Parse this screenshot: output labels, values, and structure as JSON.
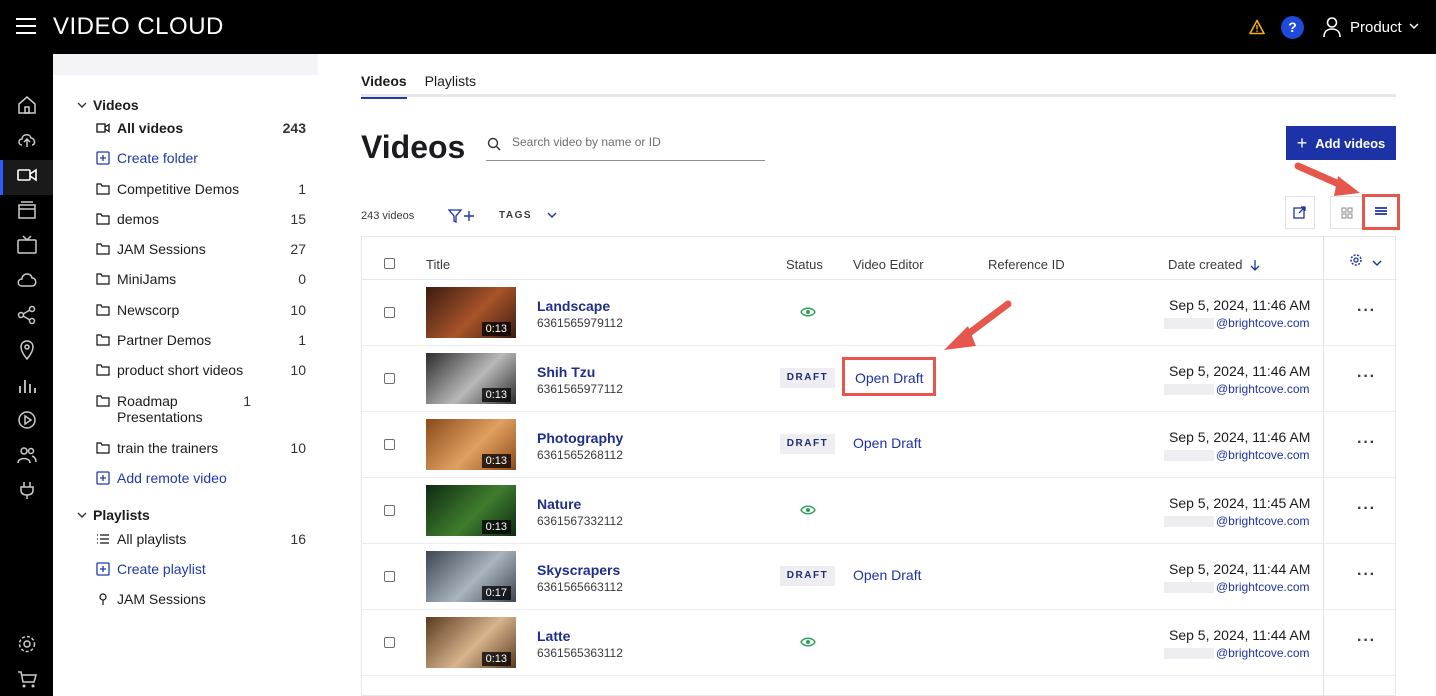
{
  "app": {
    "brand": "VIDEO CLOUD",
    "account": "Product"
  },
  "folders": {
    "videos_heading": "Videos",
    "items": [
      {
        "label": "All videos",
        "count": "243"
      },
      {
        "label": "Create folder",
        "count": ""
      },
      {
        "label": "Competitive Demos",
        "count": "1"
      },
      {
        "label": "demos",
        "count": "15"
      },
      {
        "label": "JAM Sessions",
        "count": "27"
      },
      {
        "label": "MiniJams",
        "count": "0"
      },
      {
        "label": "Newscorp",
        "count": "10"
      },
      {
        "label": "Partner Demos",
        "count": "1"
      },
      {
        "label": "product short videos",
        "count": "10"
      },
      {
        "label": "Roadmap Presentations",
        "count": "1"
      },
      {
        "label": "train the trainers",
        "count": "10"
      },
      {
        "label": "Add remote video",
        "count": ""
      }
    ],
    "playlists_heading": "Playlists",
    "playlist_items": [
      {
        "label": "All playlists",
        "count": "16"
      },
      {
        "label": "Create playlist",
        "count": ""
      },
      {
        "label": "JAM Sessions",
        "count": ""
      }
    ]
  },
  "main": {
    "tabs": [
      {
        "label": "Videos"
      },
      {
        "label": "Playlists"
      }
    ],
    "title": "Videos",
    "search_placeholder": "Search video by name or ID",
    "add_button": "Add videos",
    "video_count": "243 videos",
    "tags_label": "TAGS",
    "columns": {
      "title": "Title",
      "status": "Status",
      "editor": "Video Editor",
      "reference": "Reference ID",
      "date": "Date created"
    }
  },
  "videos": [
    {
      "title": "Landscape",
      "id": "6361565979112",
      "duration": "0:13",
      "status": "published",
      "draft_label": "",
      "editor": "",
      "date": "Sep 5, 2024, 11:46 AM",
      "email": "@brightcove.com",
      "thumb_a": "#3a1c10",
      "thumb_b": "#a8542a"
    },
    {
      "title": "Shih Tzu",
      "id": "6361565977112",
      "duration": "0:13",
      "status": "draft",
      "draft_label": "DRAFT",
      "editor": "Open Draft",
      "date": "Sep 5, 2024, 11:46 AM",
      "email": "@brightcove.com",
      "thumb_a": "#2c2c2c",
      "thumb_b": "#b9b9b9"
    },
    {
      "title": "Photography",
      "id": "6361565268112",
      "duration": "0:13",
      "status": "draft",
      "draft_label": "DRAFT",
      "editor": "Open Draft",
      "date": "Sep 5, 2024, 11:46 AM",
      "email": "@brightcove.com",
      "thumb_a": "#8a4a1a",
      "thumb_b": "#e0a060"
    },
    {
      "title": "Nature",
      "id": "6361567332112",
      "duration": "0:13",
      "status": "published",
      "draft_label": "",
      "editor": "",
      "date": "Sep 5, 2024, 11:45 AM",
      "email": "@brightcove.com",
      "thumb_a": "#0e2a12",
      "thumb_b": "#3f7d2e"
    },
    {
      "title": "Skyscrapers",
      "id": "6361565663112",
      "duration": "0:17",
      "status": "draft",
      "draft_label": "DRAFT",
      "editor": "Open Draft",
      "date": "Sep 5, 2024, 11:44 AM",
      "email": "@brightcove.com",
      "thumb_a": "#3c4650",
      "thumb_b": "#a9b4be"
    },
    {
      "title": "Latte",
      "id": "6361565363112",
      "duration": "0:13",
      "status": "published",
      "draft_label": "",
      "editor": "",
      "date": "Sep 5, 2024, 11:44 AM",
      "email": "@brightcove.com",
      "thumb_a": "#5a3a20",
      "thumb_b": "#d8b48c"
    }
  ],
  "colors": {
    "brand_blue": "#1e32a8",
    "highlight_red": "#e5574c",
    "status_green": "#2e9e5a"
  }
}
